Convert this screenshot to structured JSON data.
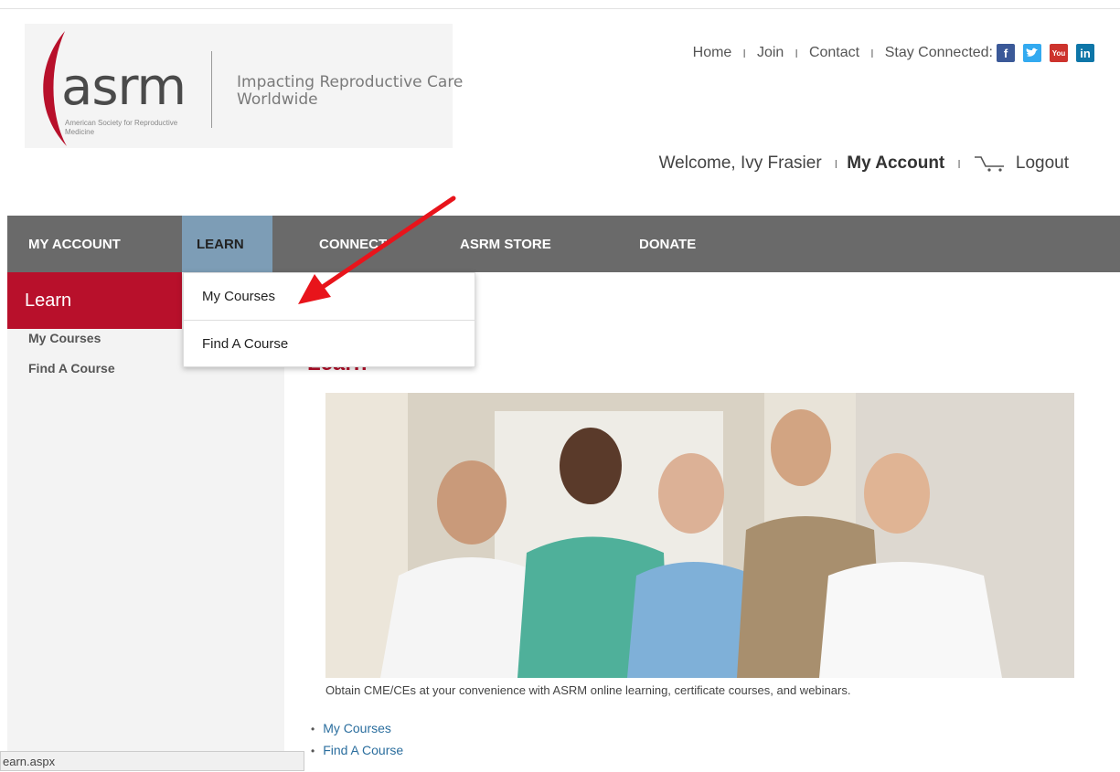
{
  "logo": {
    "text": "asrm",
    "subtitle": "American Society for Reproductive Medicine",
    "tagline": "Impacting Reproductive Care Worldwide"
  },
  "top_links": {
    "home": "Home",
    "join": "Join",
    "contact": "Contact",
    "stay_connected": "Stay Connected:",
    "social": [
      {
        "label": "f",
        "color": "#3b5998"
      },
      {
        "label": "t",
        "color": "#33aaf0"
      },
      {
        "label": "You",
        "color": "#cd332d"
      },
      {
        "label": "in",
        "color": "#0e76a8"
      }
    ],
    "separator": "I"
  },
  "welcome": {
    "text": "Welcome, Ivy Frasier",
    "my_account": "My Account",
    "logout": "Logout"
  },
  "nav": {
    "items": [
      "MY ACCOUNT",
      "LEARN",
      "CONNECT",
      "ASRM STORE",
      "DONATE"
    ],
    "active": "LEARN"
  },
  "dropdown": [
    "My Courses",
    "Find A Course"
  ],
  "sidebar": {
    "heading": "Learn",
    "links": [
      "My Courses",
      "Find A Course"
    ]
  },
  "main": {
    "title": "Learn",
    "caption": "Obtain CME/CEs at your convenience with ASRM online learning, certificate courses, and webinars.",
    "links": [
      "My Courses",
      "Find A Course"
    ]
  },
  "status_bar": "earn.aspx",
  "colors": {
    "brand_red": "#b8102b",
    "nav_gray": "#6a6a6a",
    "nav_active": "#7d9db6",
    "arrow": "#e8141b"
  }
}
